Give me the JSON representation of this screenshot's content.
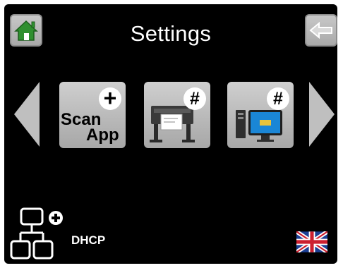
{
  "header": {
    "title": "Settings",
    "home_icon": "home-icon",
    "back_icon": "back-arrow-icon"
  },
  "carousel": {
    "prev_icon": "triangle-left-icon",
    "next_icon": "triangle-right-icon",
    "tiles": [
      {
        "id": "scan-app",
        "line1": "Scan",
        "line2": "App",
        "badge": "+",
        "icon": "scan-app-icon"
      },
      {
        "id": "plotter",
        "badge": "#",
        "icon": "large-format-printer-icon"
      },
      {
        "id": "computer",
        "badge": "#",
        "icon": "computer-monitor-icon"
      }
    ]
  },
  "footer": {
    "network_icon": "network-tree-icon",
    "network_badge": "+",
    "network_label": "DHCP",
    "language_icon": "uk-flag-icon"
  },
  "colors": {
    "screen_bg": "#000000",
    "button_gray": "#b8b8b8",
    "home_green": "#2f8f2f",
    "monitor_blue": "#1a86d6",
    "text": "#ffffff"
  }
}
